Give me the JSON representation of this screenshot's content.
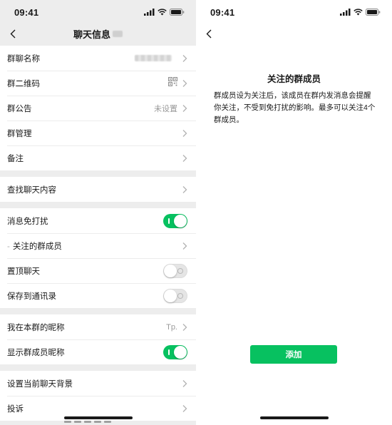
{
  "left_screen": {
    "status_time": "09:41",
    "title": "聊天信息",
    "groups": [
      [
        {
          "label": "群聊名称",
          "value": "",
          "right": "blur"
        },
        {
          "label": "群二维码",
          "value": "",
          "right": "qr"
        },
        {
          "label": "群公告",
          "value": "未设置",
          "right": "text"
        },
        {
          "label": "群管理",
          "value": "",
          "right": "none"
        },
        {
          "label": "备注",
          "value": "",
          "right": "none"
        }
      ],
      [
        {
          "label": "查找聊天内容",
          "value": "",
          "right": "none"
        }
      ],
      [
        {
          "label": "消息免打扰",
          "value": "",
          "right": "toggle-on"
        },
        {
          "label": "关注的群成员",
          "value": "",
          "right": "none",
          "prefix": "-"
        },
        {
          "label": "置顶聊天",
          "value": "",
          "right": "toggle-off"
        },
        {
          "label": "保存到通讯录",
          "value": "",
          "right": "toggle-off"
        }
      ],
      [
        {
          "label": "我在本群的昵称",
          "value": "Tp.",
          "right": "text"
        },
        {
          "label": "显示群成员昵称",
          "value": "",
          "right": "toggle-on"
        }
      ],
      [
        {
          "label": "设置当前聊天背景",
          "value": "",
          "right": "none"
        },
        {
          "label": "投诉",
          "value": "",
          "right": "none"
        }
      ]
    ]
  },
  "right_screen": {
    "status_time": "09:41",
    "tip_title": "关注的群成员",
    "tip_body": "群成员设为关注后，该成员在群内发消息会提醒你关注，不受到免打扰的影响。最多可以关注4个群成员。",
    "add_button_label": "添加"
  },
  "colors": {
    "accent_green": "#07c160",
    "background_gray": "#ededed",
    "secondary_text": "#999999"
  },
  "icons": {
    "back": "back-chevron-icon",
    "row_arrow": "chevron-right-icon",
    "qr": "qr-code-icon",
    "signal": "signal-icon",
    "wifi": "wifi-icon",
    "battery": "battery-icon"
  }
}
